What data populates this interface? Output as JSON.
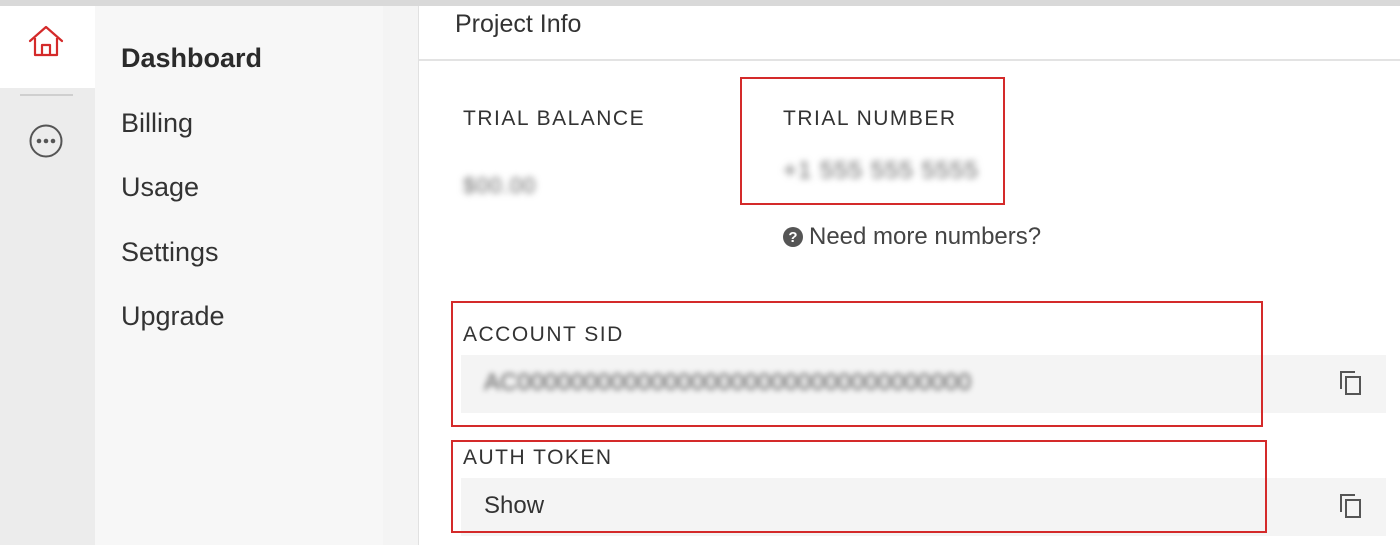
{
  "sidebar": {
    "rail_icons": [
      "home-icon",
      "more-icon"
    ],
    "items": [
      {
        "label": "Dashboard",
        "active": true
      },
      {
        "label": "Billing",
        "active": false
      },
      {
        "label": "Usage",
        "active": false
      },
      {
        "label": "Settings",
        "active": false
      },
      {
        "label": "Upgrade",
        "active": false
      }
    ]
  },
  "project_info": {
    "title": "Project Info",
    "trial_balance": {
      "label": "TRIAL BALANCE",
      "value": "$00.00"
    },
    "trial_number": {
      "label": "TRIAL NUMBER",
      "value": "+1 555 555 5555"
    },
    "help_link": "Need more numbers?",
    "account_sid": {
      "label": "ACCOUNT SID",
      "value": "AC0000000000000000000000000000000000"
    },
    "auth_token": {
      "label": "AUTH TOKEN",
      "value": "Show"
    }
  },
  "colors": {
    "accent": "#d42a2a",
    "highlight_box": "#d42a2a",
    "nav_bg": "#f7f7f7",
    "rail_bg": "#ececec"
  }
}
